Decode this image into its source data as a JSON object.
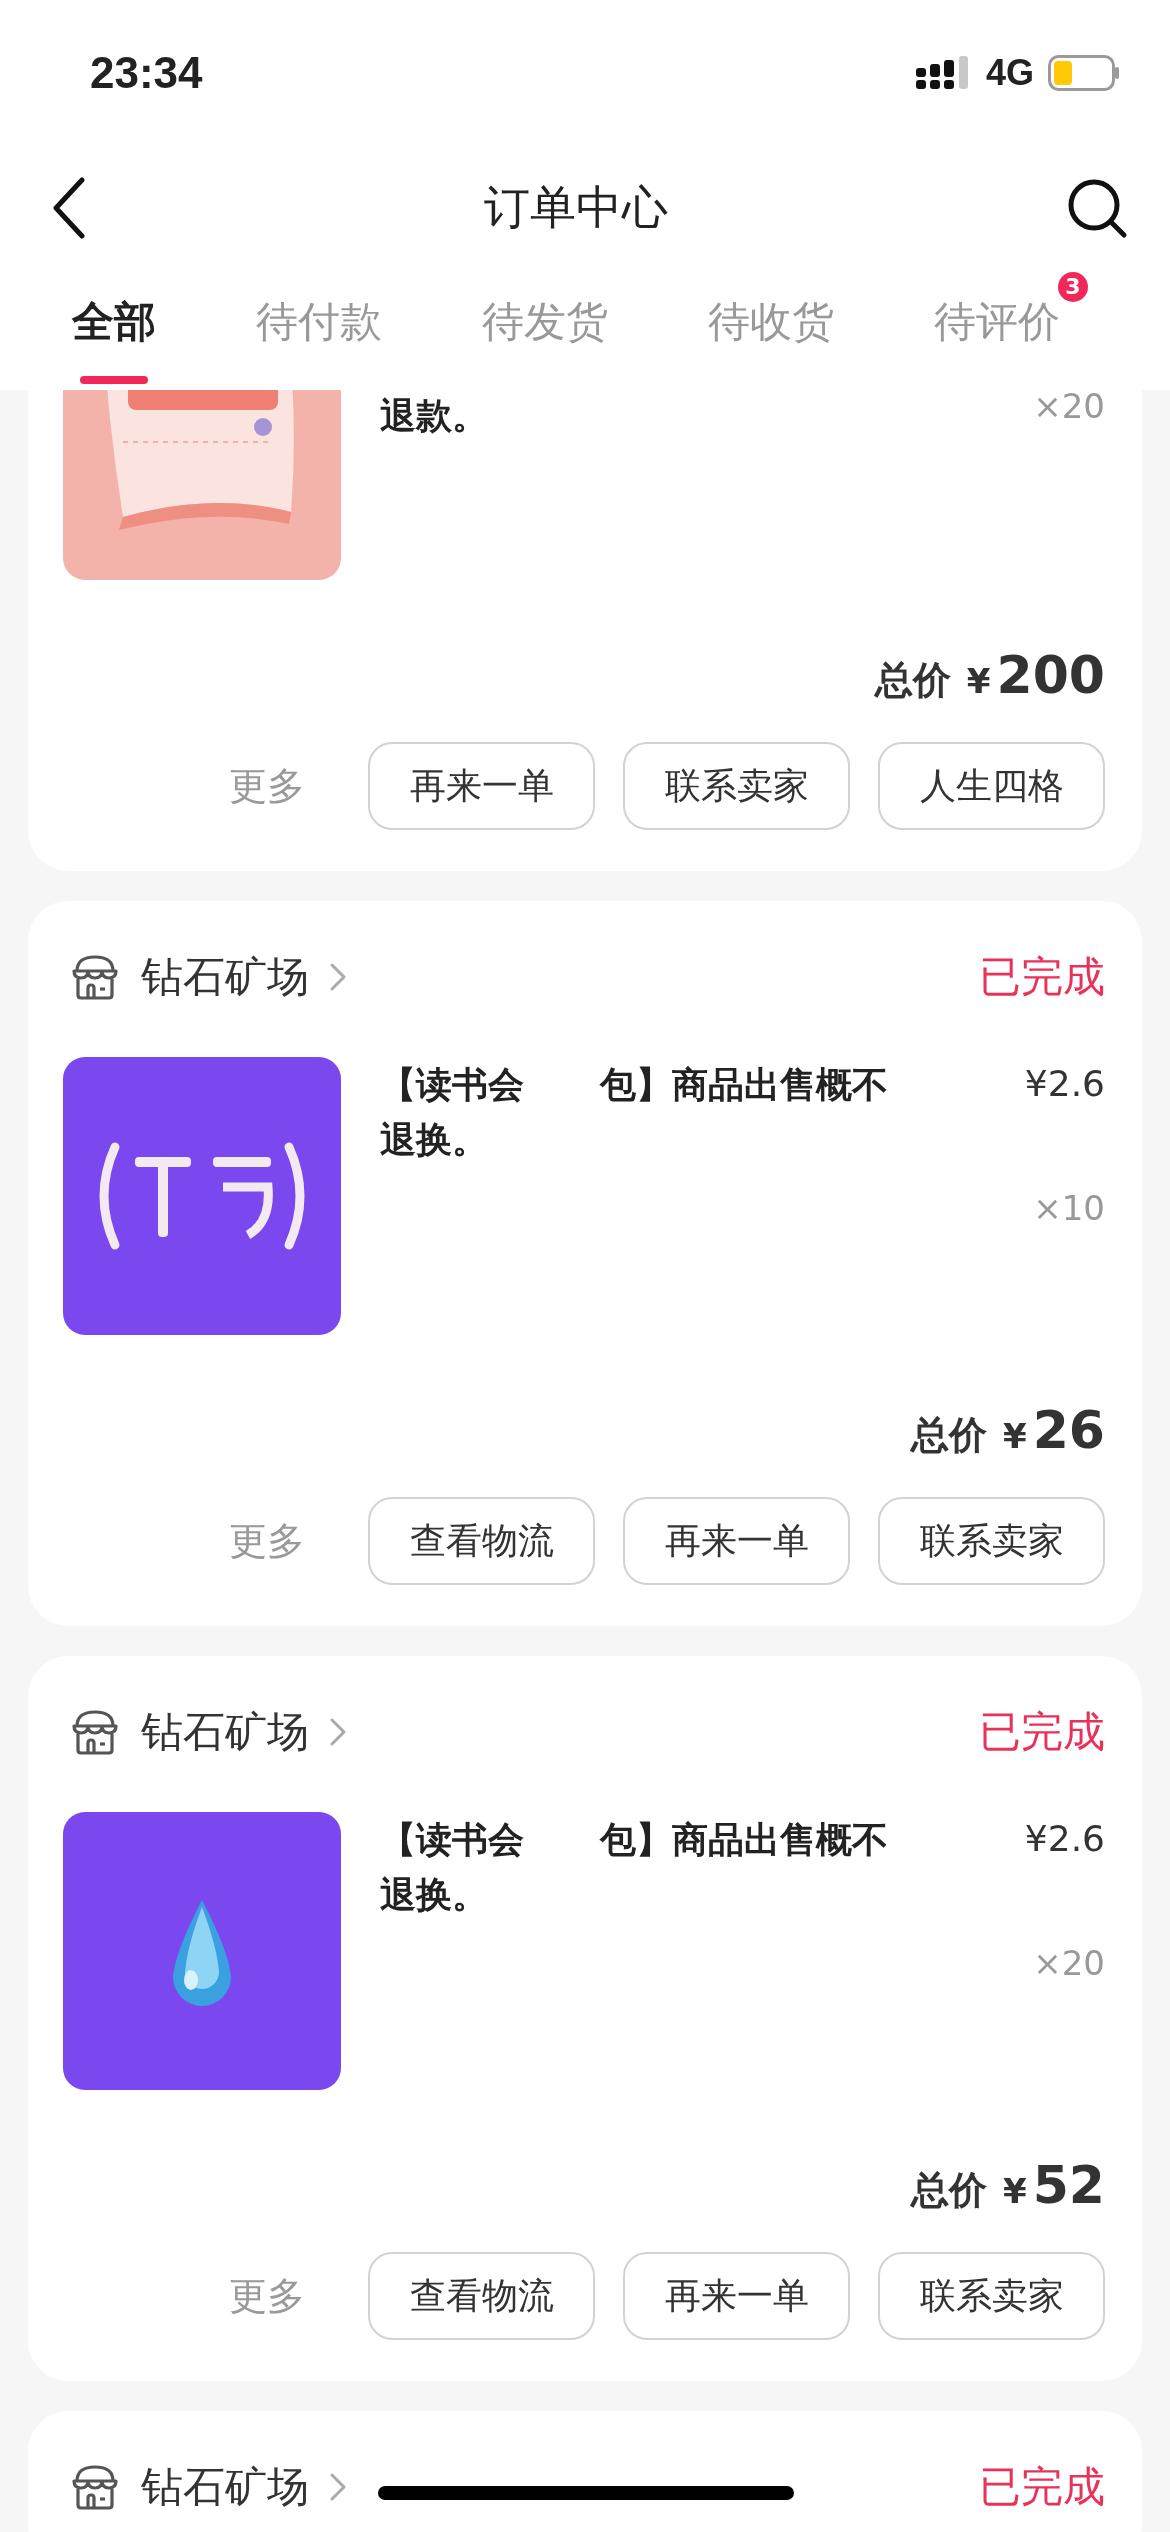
{
  "status_bar": {
    "time": "23:34",
    "network": "4G"
  },
  "nav": {
    "title": "订单中心"
  },
  "tabs": [
    {
      "label": "全部",
      "selected": true
    },
    {
      "label": "待付款",
      "selected": false
    },
    {
      "label": "待发货",
      "selected": false
    },
    {
      "label": "待收货",
      "selected": false
    },
    {
      "label": "待评价",
      "selected": false,
      "badge": "3"
    }
  ],
  "orders": [
    {
      "continued": true,
      "image": {
        "kind": "picture"
      },
      "title": "退款。",
      "quantity": "×20",
      "total_label": "总价",
      "total_currency": "¥",
      "total_amount": "200",
      "more": "更多",
      "buttons": [
        "再来一单",
        "联系卖家",
        "人生四格"
      ]
    },
    {
      "shop": "钻石矿场",
      "status": "已完成",
      "image": {
        "kind": "picture"
      },
      "title": "【读书会",
      "title_rest": "包】商品出售概不退换。",
      "price": "¥2.6",
      "quantity": "×10",
      "total_label": "总价",
      "total_currency": "¥",
      "total_amount": "26",
      "more": "更多",
      "buttons": [
        "查看物流",
        "再来一单",
        "联系卖家"
      ]
    },
    {
      "shop": "钻石矿场",
      "status": "已完成",
      "image": {
        "kind": "picture"
      },
      "title": "【读书会",
      "title_rest": "包】商品出售概不退换。",
      "price": "¥2.6",
      "quantity": "×20",
      "total_label": "总价",
      "total_currency": "¥",
      "total_amount": "52",
      "more": "更多",
      "buttons": [
        "查看物流",
        "再来一单",
        "联系卖家"
      ]
    },
    {
      "shop": "钻石矿场",
      "status": "已完成"
    }
  ]
}
